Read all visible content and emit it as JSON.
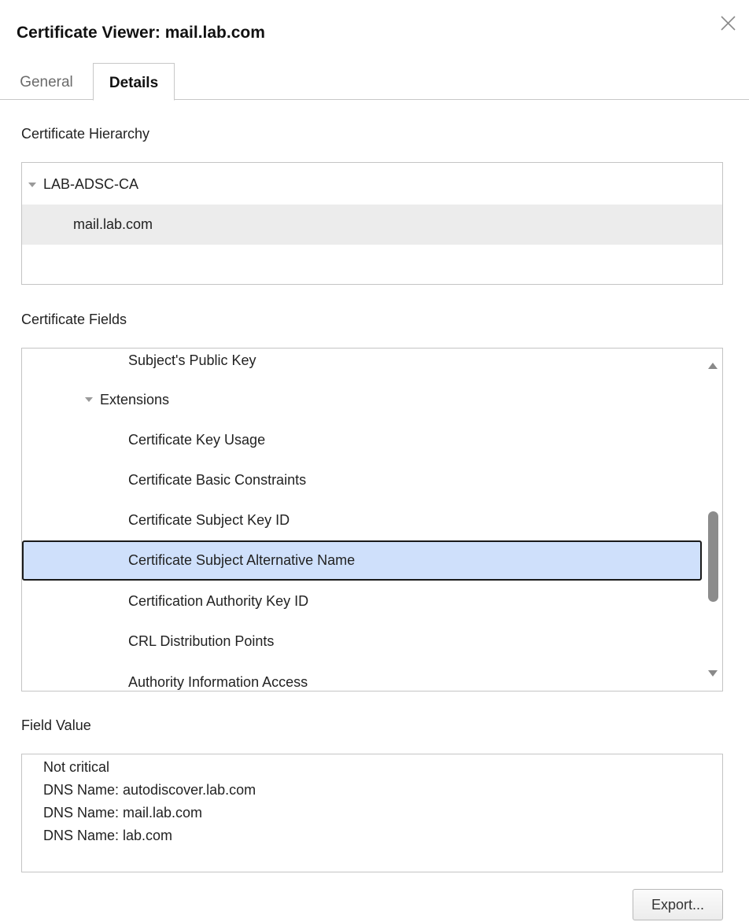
{
  "window": {
    "title": "Certificate Viewer: mail.lab.com",
    "close_icon": "close-icon"
  },
  "tabs": [
    {
      "label": "General",
      "selected": false
    },
    {
      "label": "Details",
      "selected": true
    }
  ],
  "hierarchy": {
    "label": "Certificate Hierarchy",
    "items": [
      {
        "label": "LAB-ADSC-CA",
        "expanded": true
      },
      {
        "label": "mail.lab.com",
        "selected": true
      }
    ]
  },
  "fields": {
    "label": "Certificate Fields",
    "items": [
      {
        "label": "Subject's Public Key"
      },
      {
        "label": "Extensions",
        "expanded": true
      },
      {
        "label": "Certificate Key Usage"
      },
      {
        "label": "Certificate Basic Constraints"
      },
      {
        "label": "Certificate Subject Key ID"
      },
      {
        "label": "Certificate Subject Alternative Name",
        "selected": true
      },
      {
        "label": "Certification Authority Key ID"
      },
      {
        "label": "CRL Distribution Points"
      },
      {
        "label": "Authority Information Access"
      }
    ]
  },
  "value": {
    "label": "Field Value",
    "lines": [
      "Not critical",
      "DNS Name: autodiscover.lab.com",
      "DNS Name: mail.lab.com",
      "DNS Name: lab.com"
    ]
  },
  "actions": {
    "export_label": "Export..."
  },
  "colors": {
    "selection_fill": "#cfe0fb",
    "hover_fill": "#ececec",
    "border": "#c4c4c4"
  }
}
